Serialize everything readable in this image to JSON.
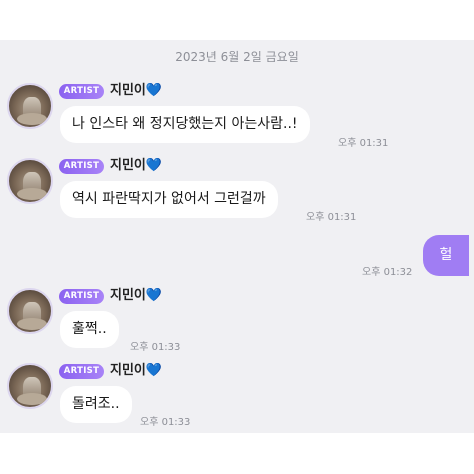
{
  "date_divider": "2023년 6월 2일 금요일",
  "badge_label": "ARTIST",
  "sender_name": "지민이",
  "heart_icon": "💙",
  "messages": [
    {
      "text": "나 인스타 왜 정지당했는지 아는사람..!",
      "time": "오후 01:31"
    },
    {
      "text": "역시 파란딱지가 없어서 그런걸까",
      "time": "오후 01:31"
    },
    {
      "text": "훌쩍..",
      "time": "오후 01:33"
    },
    {
      "text": "돌려조..",
      "time": "오후 01:33"
    }
  ],
  "my_message": {
    "text": "헐",
    "time": "오후 01:32"
  },
  "colors": {
    "accent": "#a07df3",
    "background": "#f0f0f3",
    "bubble": "#ffffff"
  }
}
